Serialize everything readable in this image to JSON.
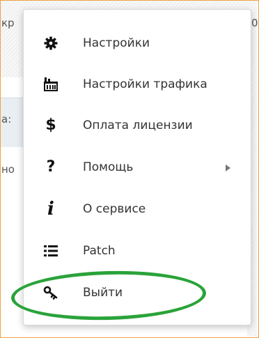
{
  "background": {
    "fragments": [
      "кр",
      "а:",
      "но",
      "0"
    ]
  },
  "menu": {
    "items": [
      {
        "label": "Настройки",
        "icon": "gear-icon",
        "has_submenu": false
      },
      {
        "label": "Настройки трафика",
        "icon": "traffic-factory-icon",
        "has_submenu": false
      },
      {
        "label": "Оплата лицензии",
        "icon": "dollar-icon",
        "has_submenu": false
      },
      {
        "label": "Помощь",
        "icon": "question-icon",
        "has_submenu": true
      },
      {
        "label": "О сервисе",
        "icon": "info-icon",
        "has_submenu": false
      },
      {
        "label": "Patch",
        "icon": "list-icon",
        "has_submenu": false
      },
      {
        "label": "Выйти",
        "icon": "key-icon",
        "has_submenu": false
      }
    ],
    "glyphs": {
      "dollar": "$",
      "question": "?",
      "info": "i"
    }
  },
  "annotation": {
    "highlight_color": "#2aa33a"
  }
}
